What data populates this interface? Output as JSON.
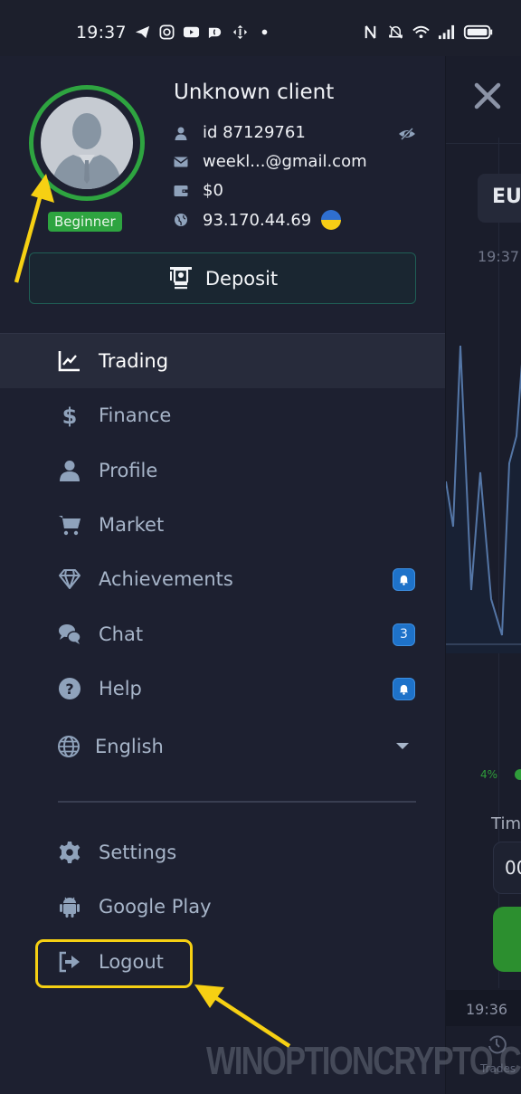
{
  "status_bar": {
    "time": "19:37",
    "left_icons": [
      "telegram-icon",
      "instagram-icon",
      "youtube-icon",
      "app-icon",
      "move-icon",
      "dot-icon"
    ],
    "right_icons": [
      "nfc-icon",
      "bell-muted-icon",
      "wifi-icon",
      "signal-icon",
      "battery-icon"
    ]
  },
  "profile": {
    "name": "Unknown client",
    "level": "Beginner",
    "id": "id 87129761",
    "email": "weekl...@gmail.com",
    "balance": "$0",
    "ip": "93.170.44.69",
    "country_flag": "Ukraine",
    "ring_color": "#2ea440"
  },
  "deposit": {
    "label": "Deposit"
  },
  "menu": {
    "items": [
      {
        "label": "Trading",
        "icon": "chart-line-icon",
        "active": true
      },
      {
        "label": "Finance",
        "icon": "dollar-icon"
      },
      {
        "label": "Profile",
        "icon": "user-icon"
      },
      {
        "label": "Market",
        "icon": "cart-icon"
      },
      {
        "label": "Achievements",
        "icon": "diamond-icon",
        "badge": "bell"
      },
      {
        "label": "Chat",
        "icon": "chat-icon",
        "badge": "3"
      },
      {
        "label": "Help",
        "icon": "question-icon",
        "badge": "bell"
      }
    ],
    "language": {
      "label": "English",
      "icon": "globe-icon"
    },
    "bottom_items": [
      {
        "label": "Settings",
        "icon": "gear-icon"
      },
      {
        "label": "Google Play",
        "icon": "android-icon"
      },
      {
        "label": "Logout",
        "icon": "logout-icon"
      }
    ]
  },
  "background_app": {
    "asset_label": "EU",
    "chart_time": "19:37",
    "percent": "4%",
    "time_label": "Tim",
    "time_value": "00",
    "strip_time": "19:36",
    "trades_label": "Trades"
  },
  "annotations": {
    "watermark": "WINOPTIONCRYPTO.COM",
    "arrow_color": "#f6d013"
  }
}
